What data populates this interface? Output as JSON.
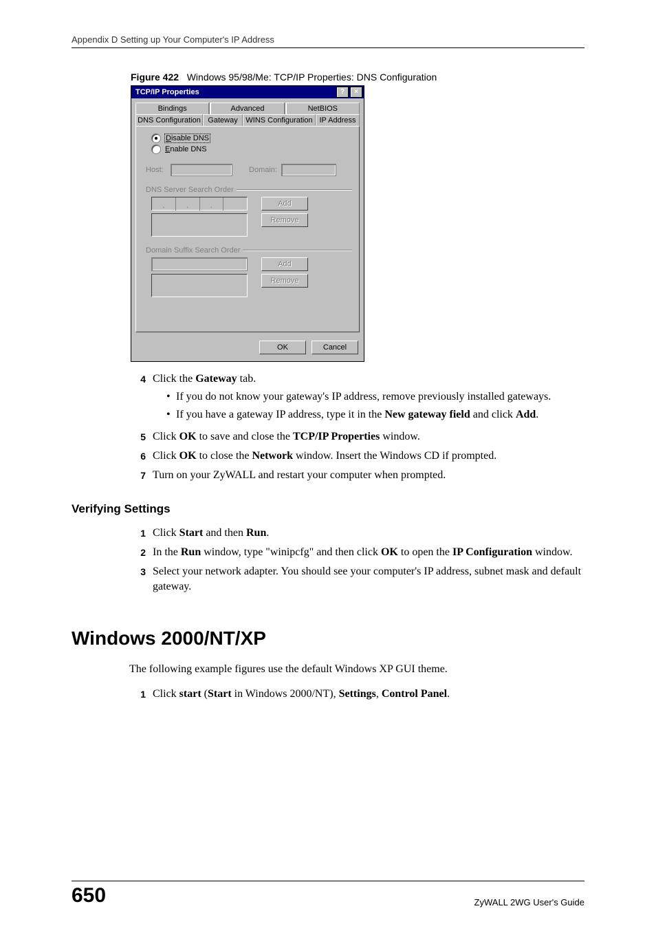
{
  "header": {
    "running": "Appendix D Setting up Your Computer's IP Address"
  },
  "figure": {
    "label": "Figure 422",
    "caption": "Windows 95/98/Me: TCP/IP Properties: DNS Configuration"
  },
  "dialog": {
    "title": "TCP/IP Properties",
    "help_glyph": "?",
    "close_glyph": "×",
    "tabs_top": [
      "Bindings",
      "Advanced",
      "NetBIOS"
    ],
    "tabs_bottom": [
      "DNS Configuration",
      "Gateway",
      "WINS Configuration",
      "IP Address"
    ],
    "radio_disable_prefix": "D",
    "radio_disable_rest": "isable DNS",
    "radio_enable_prefix": "E",
    "radio_enable_rest": "nable DNS",
    "host_prefix": "H",
    "host_rest": "ost:",
    "domain_prefix": "o",
    "domain_pre": "D",
    "domain_rest": "main:",
    "group_dns": "DNS Server Search Order",
    "group_suffix": "Domain Suffix Search Order",
    "add_prefix": "A",
    "add_rest": "dd",
    "remove_prefix": "R",
    "remove_rest": "emove",
    "ok": "OK",
    "cancel": "Cancel"
  },
  "steps_a": {
    "4": {
      "num": "4",
      "text_pre": "Click the ",
      "b1": "Gateway",
      "text_post": " tab.",
      "bullets": [
        {
          "text": "If you do not know your gateway's IP address, remove previously installed gateways."
        },
        {
          "pre": "If you have a gateway IP address, type it in the ",
          "b1": "New gateway field",
          "mid": " and click ",
          "b2": "Add",
          "post": "."
        }
      ]
    },
    "5": {
      "num": "5",
      "pre": "Click ",
      "b1": "OK",
      "mid": " to save and close the ",
      "b2": "TCP/IP Properties",
      "post": " window."
    },
    "6": {
      "num": "6",
      "pre": "Click ",
      "b1": "OK",
      "mid": " to close the ",
      "b2": "Network",
      "post": " window. Insert the Windows CD if prompted."
    },
    "7": {
      "num": "7",
      "text": "Turn on your ZyWALL and restart your computer when prompted."
    }
  },
  "verifying": {
    "heading": "Verifying Settings",
    "1": {
      "num": "1",
      "pre": "Click ",
      "b1": "Start",
      "mid": " and then ",
      "b2": "Run",
      "post": "."
    },
    "2": {
      "num": "2",
      "pre": "In the ",
      "b1": "Run",
      "mid1": " window, type \"winipcfg\" and then click ",
      "b2": "OK",
      "mid2": " to open the ",
      "b3": "IP Configuration",
      "post": " window."
    },
    "3": {
      "num": "3",
      "text": "Select your network adapter. You should see your computer's IP address, subnet mask and default gateway."
    }
  },
  "section": {
    "heading": "Windows 2000/NT/XP",
    "intro": "The following example figures use the default Windows XP GUI theme.",
    "1": {
      "num": "1",
      "pre": "Click ",
      "b1": "start",
      "mid1": " (",
      "b2": "Start",
      "mid2": " in Windows 2000/NT), ",
      "b3": "Settings",
      "mid3": ", ",
      "b4": "Control Panel",
      "post": "."
    }
  },
  "footer": {
    "page": "650",
    "guide": "ZyWALL 2WG User's Guide"
  }
}
